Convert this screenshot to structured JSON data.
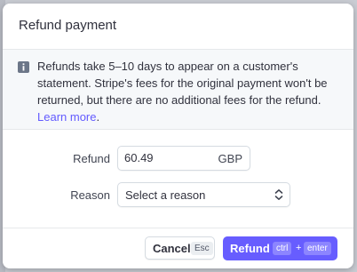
{
  "modal": {
    "title": "Refund payment"
  },
  "notice": {
    "icon": "info-icon",
    "text": "Refunds take 5–10 days to appear on a customer's statement. Stripe's fees for the original payment won't be returned, but there are no additional fees for the refund.",
    "link_text": "Learn more",
    "link_suffix": "."
  },
  "form": {
    "refund_label": "Refund",
    "amount_value": "60.49",
    "currency": "GBP",
    "reason_label": "Reason",
    "reason_selected": "Select a reason",
    "reason_icon": "chevron-up-down-icon"
  },
  "footer": {
    "cancel_label": "Cancel",
    "cancel_shortcut": "Esc",
    "refund_label": "Refund",
    "refund_shortcut_mod": "ctrl",
    "refund_shortcut_plus": "+",
    "refund_shortcut_key": "enter"
  },
  "colors": {
    "accent": "#675dff",
    "link": "#635bff",
    "notice_bg": "#f6f8fa"
  }
}
